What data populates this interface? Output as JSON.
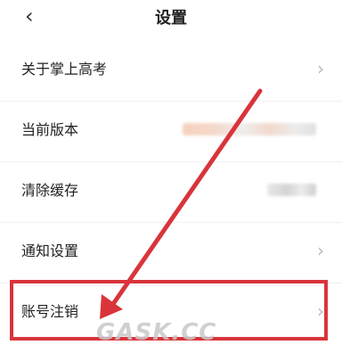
{
  "header": {
    "back_icon": "chevron-left-icon",
    "title": "设置"
  },
  "settings": {
    "items": [
      {
        "label": "关于掌上高考",
        "has_chevron": true
      },
      {
        "label": "当前版本",
        "value_blurred": true
      },
      {
        "label": "清除缓存",
        "value_blurred": true
      },
      {
        "label": "通知设置",
        "has_chevron": true
      },
      {
        "label": "账号注销",
        "has_chevron": true
      }
    ]
  },
  "annotation": {
    "color": "#d9343b",
    "highlight_target": "账号注销"
  },
  "watermark": "GASK.CC"
}
